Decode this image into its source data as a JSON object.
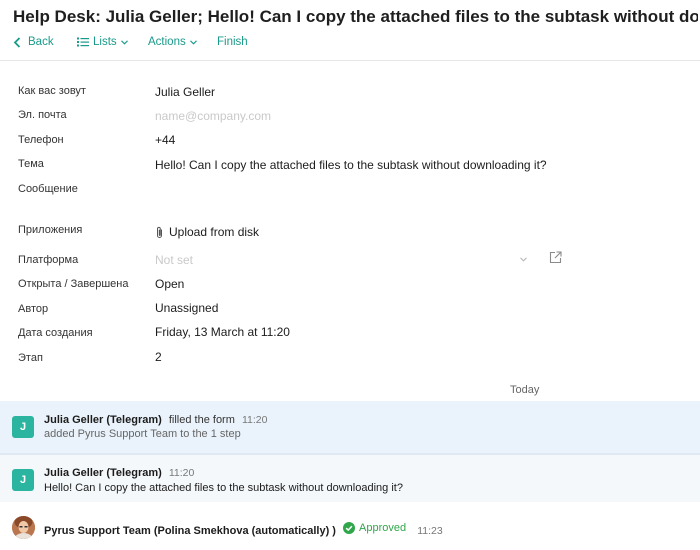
{
  "title": "Help Desk: Julia Geller; Hello! Can I copy the attached files to the subtask without downloading it?",
  "toolbar": {
    "back": "Back",
    "lists": "Lists",
    "actions": "Actions",
    "finish": "Finish"
  },
  "form": {
    "name": {
      "label": "Как вас зовут",
      "value": "Julia Geller"
    },
    "email": {
      "label": "Эл. почта",
      "placeholder": "name@company.com"
    },
    "phone": {
      "label": "Телефон",
      "value": "+44"
    },
    "subject": {
      "label": "Тема",
      "value": "Hello! Can I copy the attached files to the subtask without downloading it?"
    },
    "message": {
      "label": "Сообщение"
    },
    "attachments": {
      "label": "Приложения",
      "value": "Upload from disk"
    },
    "platform": {
      "label": "Платформа",
      "placeholder": "Not set"
    },
    "status": {
      "label": "Открыта / Завершена",
      "value": "Open"
    },
    "author": {
      "label": "Автор",
      "value": "Unassigned"
    },
    "created": {
      "label": "Дата создания",
      "value": "Friday, 13 March at 11:20"
    },
    "stage": {
      "label": "Этап",
      "value": "2"
    }
  },
  "feed": {
    "day": "Today",
    "items": [
      {
        "avatar": "J",
        "author": "Julia Geller (Telegram)",
        "action": "filled the form",
        "time": "11:20",
        "sub": "added Pyrus Support Team to the 1 step"
      },
      {
        "avatar": "J",
        "author": "Julia Geller (Telegram)",
        "time": "11:20",
        "message": "Hello! Can I copy the attached files to the subtask without downloading it?"
      },
      {
        "author": "Pyrus Support Team (Polina Smekhova (automatically) )",
        "status": "Approved",
        "time": "11:23"
      }
    ]
  },
  "colors": {
    "accent": "#1a9a8a",
    "avatar": "#2bb5a0",
    "approved": "#2fa64a",
    "feed_highlight": "#eaf3fb"
  }
}
